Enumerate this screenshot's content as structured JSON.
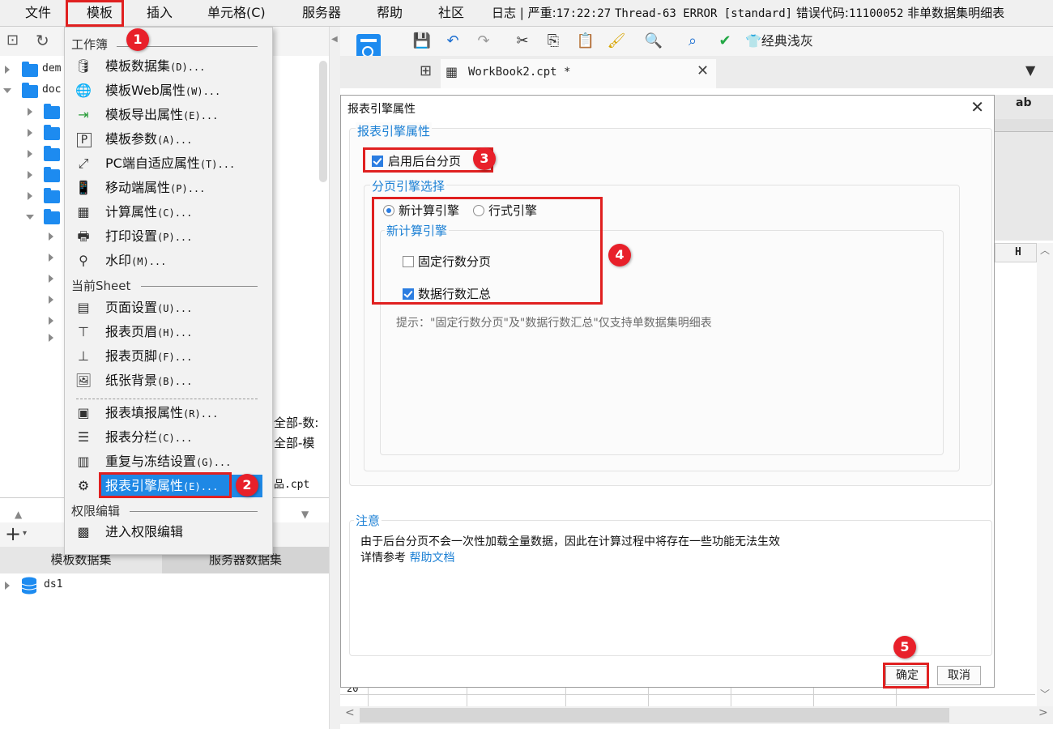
{
  "menubar": {
    "items": [
      "文件",
      "模板",
      "插入",
      "单元格(C)",
      "服务器",
      "帮助",
      "社区"
    ],
    "log_label": "日志",
    "log_level": "严重",
    "log_time": "17:22:27",
    "log_thread": "Thread-63 ERROR [standard]",
    "log_code_label": "错误代码",
    "log_code": "11100052",
    "log_message": "非单数据集明细表"
  },
  "tree": {
    "items": [
      {
        "label": "dem",
        "expanded": false
      },
      {
        "label": "doc",
        "expanded": true
      }
    ]
  },
  "partial_texts": [
    "全部-数:",
    "全部-模",
    "品.cpt"
  ],
  "dropdown": {
    "workbook_header": "工作簿",
    "workbook_items": [
      {
        "label": "模板数据集",
        "shortcut": "(D)...",
        "icon": "database-icon"
      },
      {
        "label": "模板Web属性",
        "shortcut": "(W)...",
        "icon": "globe-gear-icon"
      },
      {
        "label": "模板导出属性",
        "shortcut": "(E)...",
        "icon": "export-icon"
      },
      {
        "label": "模板参数",
        "shortcut": "(A)...",
        "icon": "parameter-icon"
      },
      {
        "label": "PC端自适应属性",
        "shortcut": "(T)...",
        "icon": "resize-icon"
      },
      {
        "label": "移动端属性",
        "shortcut": "(P)...",
        "icon": "mobile-icon"
      },
      {
        "label": "计算属性",
        "shortcut": "(C)...",
        "icon": "calculator-icon"
      },
      {
        "label": "打印设置",
        "shortcut": "(P)...",
        "icon": "printer-icon"
      },
      {
        "label": "水印",
        "shortcut": "(M)...",
        "icon": "stamp-icon"
      }
    ],
    "sheet_header": "当前Sheet",
    "sheet_items": [
      {
        "label": "页面设置",
        "shortcut": "(U)...",
        "icon": "page-setup-icon"
      },
      {
        "label": "报表页眉",
        "shortcut": "(H)...",
        "icon": "header-icon"
      },
      {
        "label": "报表页脚",
        "shortcut": "(F)...",
        "icon": "footer-icon"
      },
      {
        "label": "纸张背景",
        "shortcut": "(B)...",
        "icon": "image-icon"
      },
      {
        "label": "报表填报属性",
        "shortcut": "(R)...",
        "icon": "form-fill-icon"
      },
      {
        "label": "报表分栏",
        "shortcut": "(C)...",
        "icon": "columns-icon"
      },
      {
        "label": "重复与冻结设置",
        "shortcut": "(G)...",
        "icon": "freeze-icon"
      },
      {
        "label": "报表引擎属性",
        "shortcut": "(E)...",
        "icon": "engine-icon"
      }
    ],
    "permission_header": "权限编辑",
    "permission_items": [
      {
        "label": "进入权限编辑",
        "shortcut": "",
        "icon": "permission-icon"
      }
    ]
  },
  "dataset_tabs": [
    "模板数据集",
    "服务器数据集"
  ],
  "dataset_items": [
    "ds1"
  ],
  "toolbar": {
    "theme_label": "经典浅灰"
  },
  "tab": {
    "name": "WorkBook2.cpt *"
  },
  "sheet": {
    "column_letter": "H",
    "row_number": "20",
    "partial_label": "ab"
  },
  "dialog": {
    "title": "报表引擎属性",
    "group_title": "报表引擎属性",
    "background_paging_label": "启用后台分页",
    "background_paging_checked": true,
    "engine_select_title": "分页引擎选择",
    "engine_options": [
      "新计算引擎",
      "行式引擎"
    ],
    "engine_selected": "新计算引擎",
    "new_engine_title": "新计算引擎",
    "fixed_rows_label": "固定行数分页",
    "fixed_rows_checked": false,
    "row_summary_label": "数据行数汇总",
    "row_summary_checked": true,
    "hint": "提示：\"固定行数分页\"及\"数据行数汇总\"仅支持单数据集明细表",
    "note_title": "注意",
    "note_line1": "由于后台分页不会一次性加载全量数据，因此在计算过程中将存在一些功能无法生效",
    "note_line2_prefix": "详情参考",
    "note_link": "帮助文档",
    "ok_label": "确定",
    "cancel_label": "取消"
  },
  "annotations": [
    "1",
    "2",
    "3",
    "4",
    "5"
  ],
  "colors": {
    "accent": "#1e88e5",
    "annotation_red": "#e02020",
    "group_title_blue": "#1a7fd4"
  }
}
